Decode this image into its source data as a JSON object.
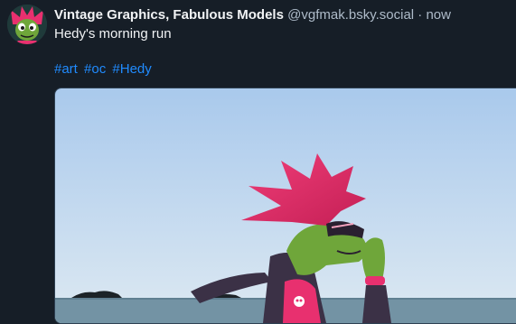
{
  "post": {
    "author_name": "Vintage Graphics, Fabulous Models",
    "author_handle": "@vgfmak.bsky.social",
    "separator": "·",
    "timestamp": "now",
    "text": "Hedy's morning run",
    "hashtags": [
      "#art",
      "#oc",
      "#Hedy"
    ]
  },
  "colors": {
    "background": "#161e27",
    "link": "#208bfe",
    "muted_text": "#aebbc9",
    "sky_top": "#b6d3ee",
    "sea": "#6f90a2",
    "character_hair": "#e8306f",
    "character_skin": "#6fa63a"
  }
}
